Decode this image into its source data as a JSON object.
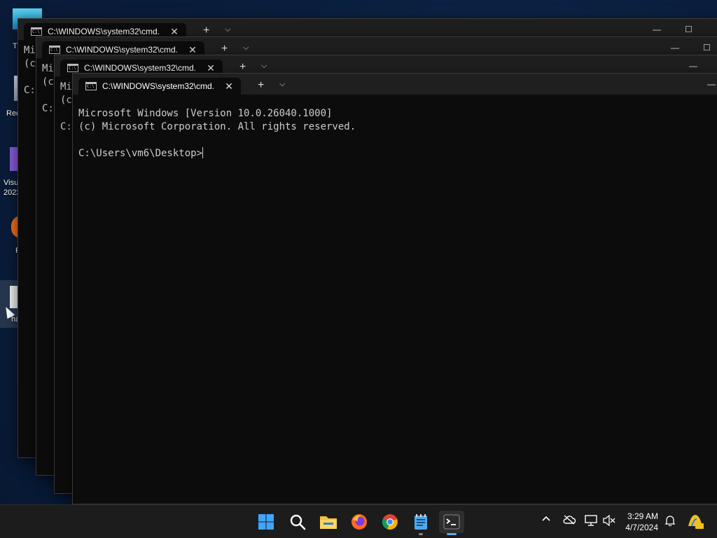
{
  "desktop": {
    "icons": [
      {
        "label": "T",
        "icon": "this-pc-icon"
      },
      {
        "label": "Rec",
        "icon": "recycle-bin-icon"
      },
      {
        "label": "Visu",
        "label2": "2022",
        "icon": "visual-studio-icon"
      },
      {
        "label": "F",
        "icon": "firefox-desktop-icon"
      },
      {
        "label": "ha",
        "icon": "file-icon"
      }
    ]
  },
  "windows": [
    {
      "tab_title": "C:\\WINDOWS\\system32\\cmd.",
      "lines": [
        "Mi",
        "(c",
        "",
        "C:"
      ]
    },
    {
      "tab_title": "C:\\WINDOWS\\system32\\cmd.",
      "lines": [
        "Mi",
        "(c",
        "",
        "C:"
      ]
    },
    {
      "tab_title": "C:\\WINDOWS\\system32\\cmd.",
      "lines": [
        "Mi",
        "(c",
        "",
        "C:"
      ]
    },
    {
      "tab_title": "C:\\WINDOWS\\system32\\cmd.",
      "lines": [
        "Microsoft Windows [Version 10.0.26040.1000]",
        "(c) Microsoft Corporation. All rights reserved.",
        "",
        "C:\\Users\\vm6\\Desktop>"
      ]
    }
  ],
  "tab_controls": {
    "new_tab": "+",
    "dropdown": "⌵",
    "close": "✕"
  },
  "window_controls": {
    "minimize": "—",
    "maximize": "☐"
  },
  "taskbar": {
    "apps": [
      {
        "name": "start",
        "icon": "windows-start-icon"
      },
      {
        "name": "search",
        "icon": "search-icon"
      },
      {
        "name": "file-explorer",
        "icon": "folder-icon"
      },
      {
        "name": "firefox",
        "icon": "firefox-icon"
      },
      {
        "name": "chrome",
        "icon": "chrome-icon"
      },
      {
        "name": "notepad",
        "icon": "notepad-icon"
      },
      {
        "name": "terminal",
        "icon": "terminal-icon",
        "active": true
      }
    ],
    "tray": {
      "chevron": "^",
      "time": "3:29 AM",
      "date": "4/7/2024"
    }
  },
  "colors": {
    "accent": "#5fa8e8",
    "terminal_bg": "#0c0c0c",
    "titlebar": "#1f1f1f",
    "taskbar": "#1c1c1c"
  }
}
